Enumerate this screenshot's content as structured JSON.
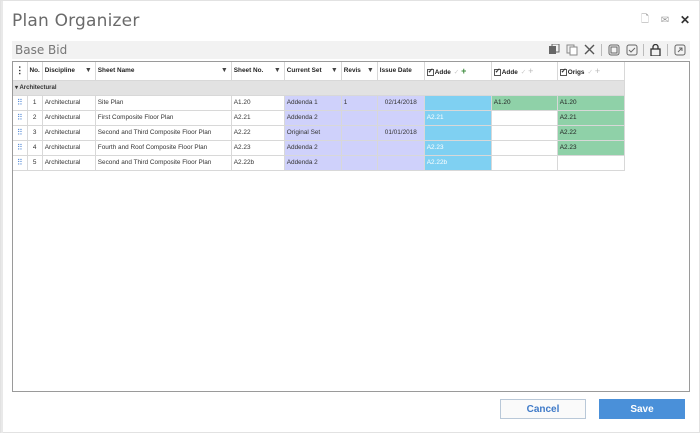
{
  "window": {
    "title": "Plan Organizer",
    "close_glyph": "✕",
    "new_glyph": "🗋",
    "mail_glyph": "✉"
  },
  "subheader": {
    "title": "Base Bid"
  },
  "toolbar": {
    "icons": [
      "stack-icon",
      "copy-icon",
      "delete-icon",
      "page-icon",
      "page-check-icon",
      "lock-icon",
      "export-icon"
    ]
  },
  "grid": {
    "columns": {
      "menu": "⋮",
      "no": "No.",
      "discipline": "Discipline",
      "sheet_name": "Sheet Name",
      "sheet_no": "Sheet No.",
      "current_set": "Current Set",
      "revis": "Revis",
      "issue_date": "Issue Date",
      "addendum1": "Adde",
      "addendum2": "Adde",
      "original": "Origs",
      "filter_glyph": "▼",
      "check_glyph": "✓",
      "plus_glyph": "+"
    },
    "group": "Architectural",
    "group_toggle": "▾",
    "rows": [
      {
        "handle": "⠿",
        "no": "1",
        "discipline": "Architectural",
        "sheet_name": "Site Plan",
        "sheet_no": "A1.20",
        "current_set": "Addenda 1",
        "revis": "1",
        "issue_date": "02/14/2018",
        "addendum1": "",
        "addendum2": "A1.20",
        "original": "A1.20"
      },
      {
        "handle": "⠿",
        "no": "2",
        "discipline": "Architectural",
        "sheet_name": "First Composite Floor Plan",
        "sheet_no": "A2.21",
        "current_set": "Addenda 2",
        "revis": "",
        "issue_date": "",
        "addendum1": "A2.21",
        "addendum2": "",
        "original": "A2.21"
      },
      {
        "handle": "⠿",
        "no": "3",
        "discipline": "Architectural",
        "sheet_name": "Second and Third Composite Floor Plan",
        "sheet_no": "A2.22",
        "current_set": "Original Set",
        "revis": "",
        "issue_date": "01/01/2018",
        "addendum1": "",
        "addendum2": "",
        "original": "A2.22"
      },
      {
        "handle": "⠿",
        "no": "4",
        "discipline": "Architectural",
        "sheet_name": "Fourth and Roof Composite Floor Plan",
        "sheet_no": "A2.23",
        "current_set": "Addenda 2",
        "revis": "",
        "issue_date": "",
        "addendum1": "A2.23",
        "addendum2": "",
        "original": "A2.23"
      },
      {
        "handle": "⠿",
        "no": "5",
        "discipline": "Architectural",
        "sheet_name": "Second and Third Composite Floor Plan",
        "sheet_no": "A2.22b",
        "current_set": "Addenda 2",
        "revis": "",
        "issue_date": "",
        "addendum1": "A2.22b",
        "addendum2": "",
        "original": ""
      }
    ]
  },
  "footer": {
    "cancel_label": "Cancel",
    "save_label": "Save"
  },
  "colors": {
    "set_column": "#cfd1fb",
    "addendum_blue": "#7fd0f2",
    "sheet_green": "#8fd1a8",
    "save_button": "#4a90d9"
  }
}
